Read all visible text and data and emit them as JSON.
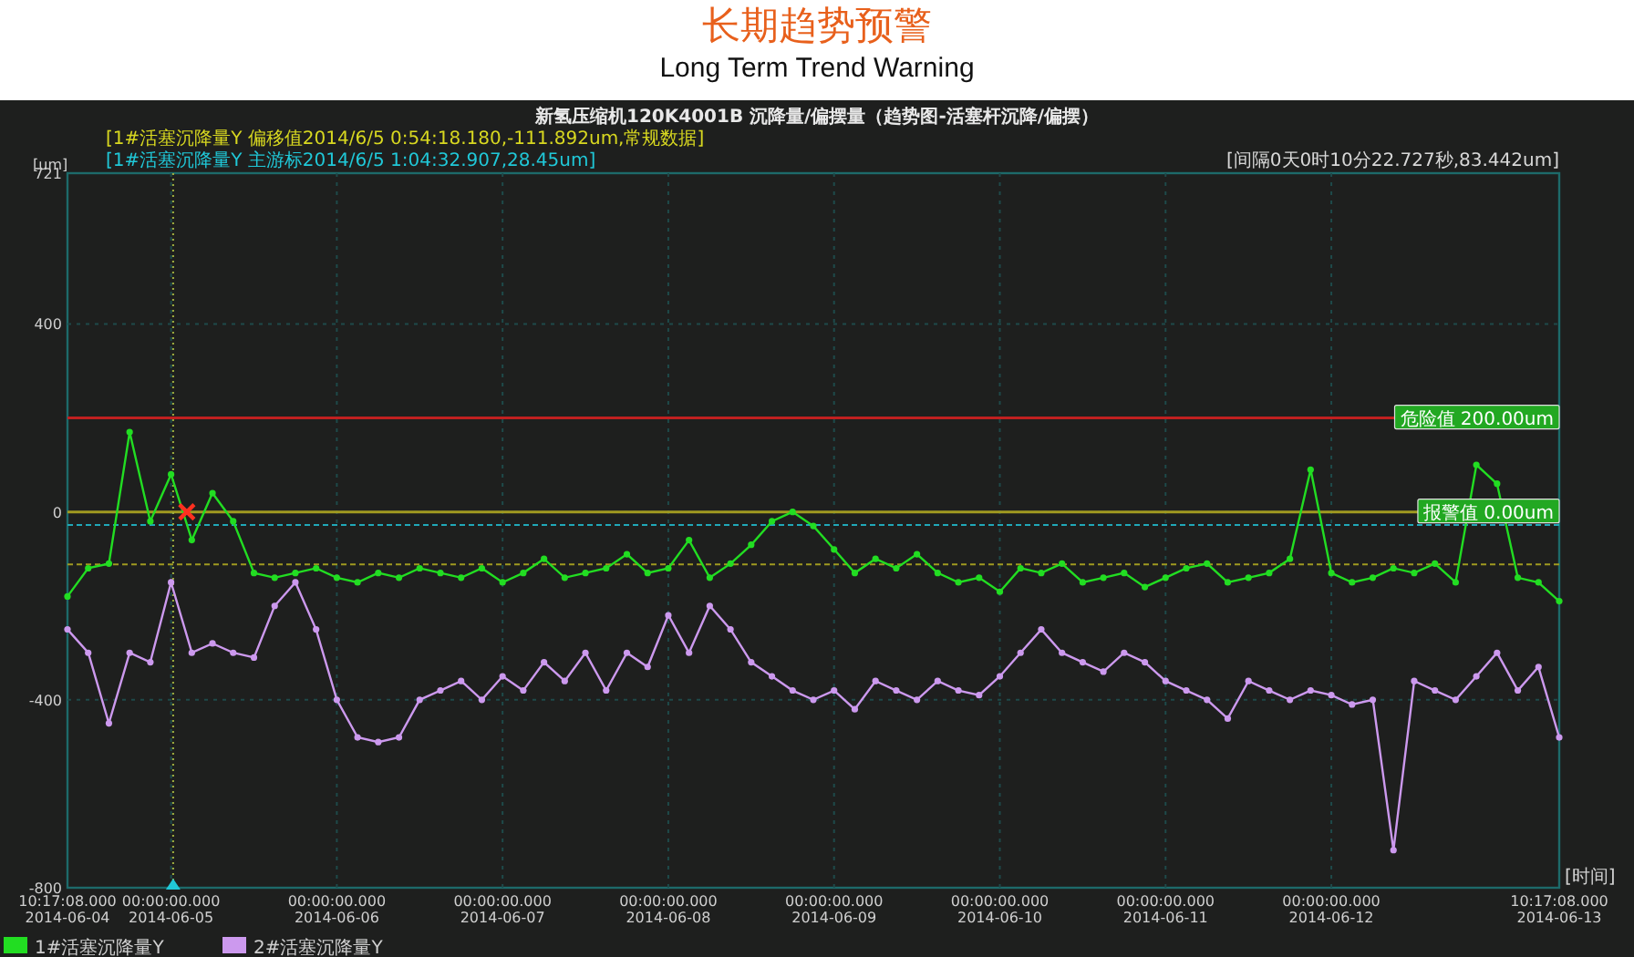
{
  "header": {
    "title": "长期趋势预警",
    "subtitle": "Long Term Trend Warning"
  },
  "chart": {
    "title": "新氢压缩机120K4001B 沉降量/偏摆量（趋势图-活塞杆沉降/偏摆）",
    "unit": "[um]",
    "cursor_readouts": [
      {
        "label": "[1#活塞沉降量Y 偏移值2014/6/5 0:54:18.180,-111.892um,常规数据]",
        "color": "#d8d820"
      },
      {
        "label": "[1#活塞沉降量Y 主游标2014/6/5 1:04:32.907,28.45um]",
        "color": "#20c8d8"
      }
    ],
    "interval_readout": "[间隔0天0时10分22.727秒,83.442um]",
    "time_axis_label": "[时间]",
    "chart_data": {
      "type": "line",
      "grid": true,
      "legend": true,
      "categories": [
        "10:17:08.000\n2014-06-04",
        null,
        null,
        null,
        null,
        "00:00:00.000\n2014-06-05",
        null,
        null,
        null,
        null,
        null,
        null,
        null,
        "00:00:00.000\n2014-06-06",
        null,
        null,
        null,
        null,
        null,
        null,
        null,
        "00:00:00.000\n2014-06-07",
        null,
        null,
        null,
        null,
        null,
        null,
        null,
        "00:00:00.000\n2014-06-08",
        null,
        null,
        null,
        null,
        null,
        null,
        null,
        "00:00:00.000\n2014-06-09",
        null,
        null,
        null,
        null,
        null,
        null,
        null,
        "00:00:00.000\n2014-06-10",
        null,
        null,
        null,
        null,
        null,
        null,
        null,
        "00:00:00.000\n2014-06-11",
        null,
        null,
        null,
        null,
        null,
        null,
        null,
        "00:00:00.000\n2014-06-12",
        null,
        null,
        null,
        null,
        null,
        null,
        null,
        null,
        null,
        null,
        "10:17:08.000\n2014-06-13"
      ],
      "series": [
        {
          "name": "1#活塞沉降量Y",
          "color": "#22dd22",
          "marker": "circle",
          "values": [
            -180,
            -120,
            -110,
            170,
            -20,
            80,
            -60,
            40,
            -20,
            -130,
            -140,
            -130,
            -120,
            -140,
            -150,
            -130,
            -140,
            -120,
            -130,
            -140,
            -120,
            -150,
            -130,
            -100,
            -140,
            -130,
            -120,
            -90,
            -130,
            -120,
            -60,
            -140,
            -110,
            -70,
            -20,
            0,
            -30,
            -80,
            -130,
            -100,
            -120,
            -90,
            -130,
            -150,
            -140,
            -170,
            -120,
            -130,
            -110,
            -150,
            -140,
            -130,
            -160,
            -140,
            -120,
            -110,
            -150,
            -140,
            -130,
            -100,
            90,
            -130,
            -150,
            -140,
            -120,
            -130,
            -110,
            -150,
            100,
            60,
            -140,
            -150,
            -190
          ]
        },
        {
          "name": "2#活塞沉降量Y",
          "color": "#cc99ee",
          "marker": "circle",
          "values": [
            -250,
            -300,
            -450,
            -300,
            -320,
            -150,
            -300,
            -280,
            -300,
            -310,
            -200,
            -150,
            -250,
            -400,
            -480,
            -490,
            -480,
            -400,
            -380,
            -360,
            -400,
            -350,
            -380,
            -320,
            -360,
            -300,
            -380,
            -300,
            -330,
            -220,
            -300,
            -200,
            -250,
            -320,
            -350,
            -380,
            -400,
            -380,
            -420,
            -360,
            -380,
            -400,
            -360,
            -380,
            -390,
            -350,
            -300,
            -250,
            -300,
            -320,
            -340,
            -300,
            -320,
            -360,
            -380,
            -400,
            -440,
            -360,
            -380,
            -400,
            -380,
            -390,
            -410,
            -400,
            -720,
            -360,
            -380,
            -400,
            -350,
            -300,
            -380,
            -330,
            -480
          ]
        }
      ],
      "ylim": [
        -800,
        721
      ],
      "yticks": [
        721,
        400,
        0,
        -400,
        -800
      ],
      "ref_lines": [
        {
          "axis": "y",
          "value": 200,
          "label": "危险值 200.00um",
          "color": "#c02020"
        },
        {
          "axis": "y",
          "value": 0,
          "label": "报警值 0.00um",
          "color": "#a09a20"
        },
        {
          "axis": "y",
          "value": -28,
          "color": "#20a8b8"
        },
        {
          "axis": "y",
          "value": -112,
          "color": "#a09a20"
        }
      ]
    }
  }
}
